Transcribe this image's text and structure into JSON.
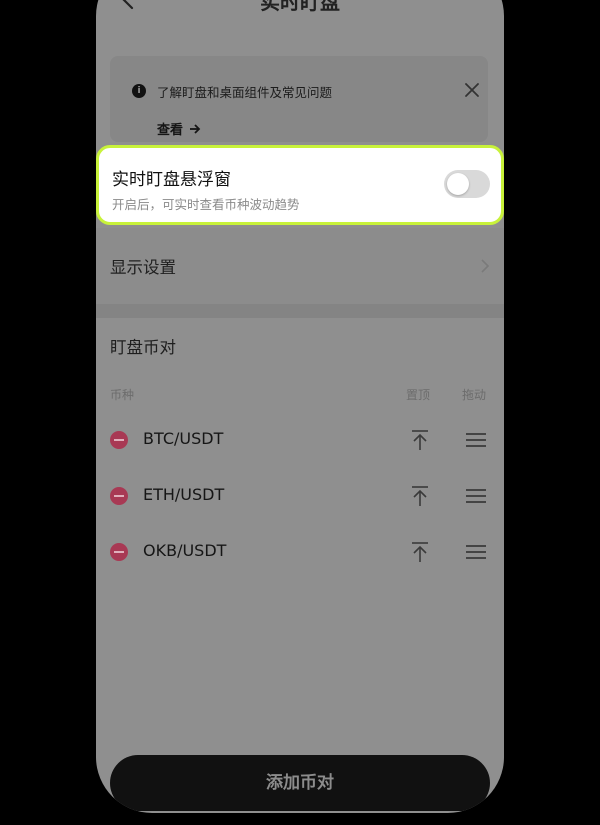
{
  "header": {
    "title": "实时盯盘"
  },
  "info": {
    "text": "了解盯盘和桌面组件及常见问题",
    "link": "查看",
    "icon_glyph": "i"
  },
  "floating": {
    "title": "实时盯盘悬浮窗",
    "subtitle": "开启后，可实时查看币种波动趋势",
    "enabled": false,
    "accent": "#c8f23a"
  },
  "display": {
    "label": "显示设置"
  },
  "pairs": {
    "title": "盯盘币对",
    "columns": {
      "coin": "币种",
      "pin": "置顶",
      "drag": "拖动"
    },
    "items": [
      {
        "name": "BTC/USDT"
      },
      {
        "name": "ETH/USDT"
      },
      {
        "name": "OKB/USDT"
      }
    ]
  },
  "footer": {
    "add_label": "添加币对"
  },
  "colors": {
    "remove": "#a83954",
    "primary_button": "#111111"
  }
}
